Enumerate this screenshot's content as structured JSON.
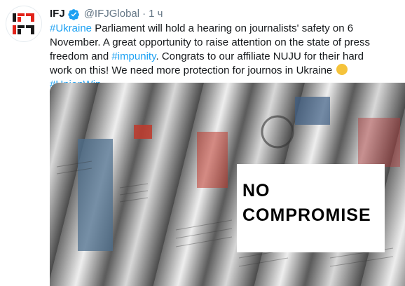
{
  "account": {
    "name": "IFJ",
    "handle": "@IFJGlobal",
    "separator": "·",
    "time": "1 ч",
    "avatar_text": "IFJ",
    "verified_icon": "verified-badge-icon",
    "colors": {
      "brand_red": "#e2231a",
      "link": "#1da1f2",
      "verified": "#1da1f2"
    }
  },
  "tweet": {
    "hashtag_ukraine": "#Ukraine",
    "text_1": " Parliament will hold a hearing on journalists' safety on 6 November. A great opportunity to raise attention on the state of press freedom and ",
    "hashtag_impunity": "#impunity",
    "text_2": ". Congrats to our affiliate NUJU for their hard work on this! We need more protection for journos in Ukraine ",
    "emoji": "raised-fist-emoji",
    "hashtag_unionwin": "#UnionWin"
  },
  "media": {
    "overlay_line1": "NO",
    "overlay_line2": "COMPROMISE"
  }
}
